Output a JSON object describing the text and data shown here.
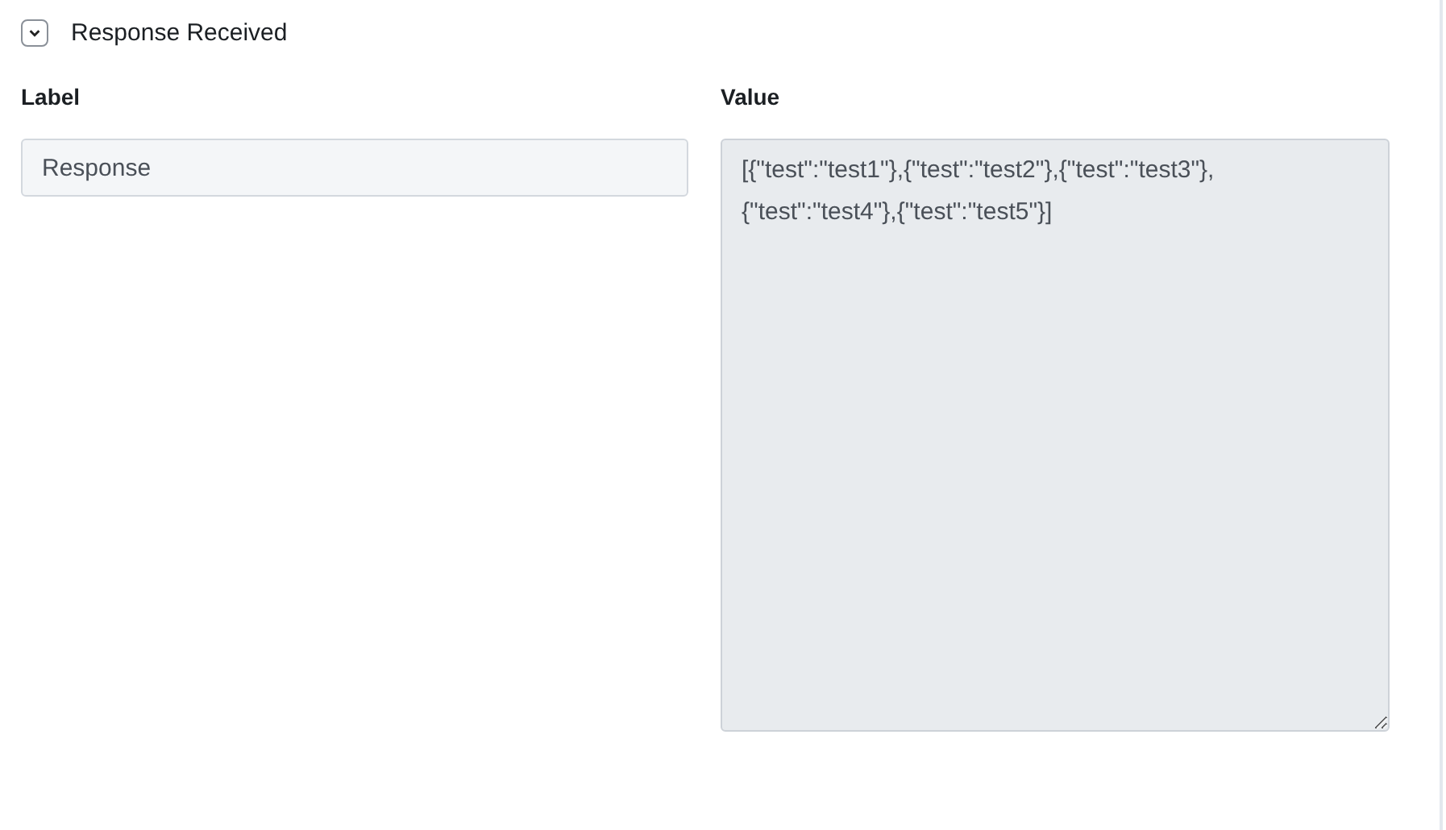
{
  "section": {
    "title": "Response Received",
    "expanded": true
  },
  "fields": [
    {
      "heading": "Label",
      "value": "Response",
      "kind": "input"
    },
    {
      "heading": "Value",
      "value": "[{\"test\":\"test1\"},{\"test\":\"test2\"},{\"test\":\"test3\"},{\"test\":\"test4\"},{\"test\":\"test5\"}]",
      "kind": "textarea"
    }
  ]
}
